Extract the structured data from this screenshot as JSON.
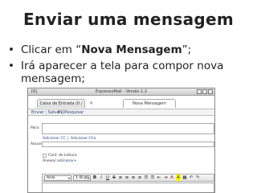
{
  "slide": {
    "title": "Enviar uma mensagem",
    "bullets": [
      {
        "dot": "•",
        "pre": "Clicar em “",
        "bold": "Nova Mensagem",
        "post": "”;"
      },
      {
        "dot": "•",
        "text": "Irá aparecer a tela para compor nova mensagem;"
      }
    ]
  },
  "screenshot": {
    "window_title": "ExpressoMail - Versão 1.2",
    "window_left_label": "[6]",
    "tabs": [
      {
        "label": "Caixa de Entrada (0 / 61)"
      },
      {
        "label": "Nova Mensagem"
      }
    ],
    "tab_close_glyph": "×",
    "actions": {
      "send": "Enviar",
      "save": "Salvar",
      "search": "Pesquisar",
      "separator": "|"
    },
    "form": {
      "to_label": "Para:",
      "add_cc_link": "Adicionar CC",
      "add_cco_link": "Adicionar CCo",
      "link_separator": "|",
      "subject_label": "Assunto:",
      "read_receipt_label": "Conf. de Leitura",
      "attachments_label": "Anexos:",
      "add_attachment_link": "adicionar+"
    },
    "toolbar": {
      "font_family": "Arial",
      "font_size": "1 (8 pt)",
      "caret": "▾",
      "buttons": [
        "B",
        "I",
        "U",
        "S",
        "≡",
        "≡",
        "≡",
        "≡",
        "☰",
        "☰",
        "⇤",
        "⇥",
        "A",
        "A",
        "▦",
        "↶",
        "↷"
      ]
    }
  }
}
